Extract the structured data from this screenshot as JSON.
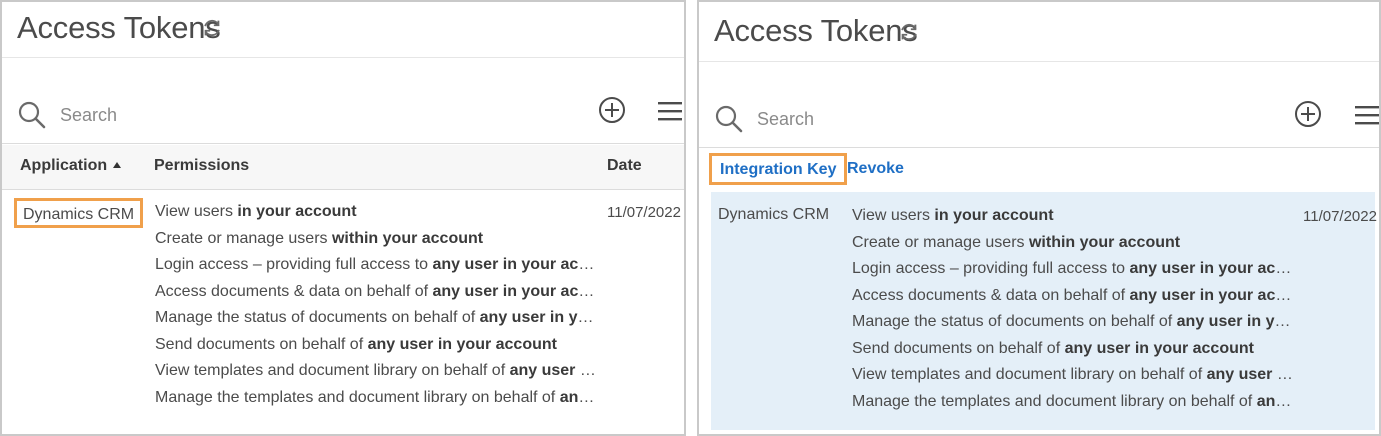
{
  "panels": [
    {
      "title": "Access Tokens",
      "search": {
        "placeholder": "Search"
      },
      "columns": {
        "application": "Application",
        "permissions": "Permissions",
        "date": "Date"
      },
      "row": {
        "application": "Dynamics CRM",
        "date": "11/07/2022"
      }
    },
    {
      "title": "Access Tokens",
      "search": {
        "placeholder": "Search"
      },
      "actions": {
        "integration_key": "Integration Key",
        "revoke": "Revoke"
      },
      "row": {
        "application": "Dynamics CRM",
        "date": "11/07/2022"
      }
    }
  ],
  "permissions": [
    {
      "plain": "View users ",
      "bold": "in your account"
    },
    {
      "plain": "Create or manage users ",
      "bold": "within your account"
    },
    {
      "plain": "Login access – providing full access to ",
      "bold": "any user in your account"
    },
    {
      "plain": "Access documents & data on behalf of ",
      "bold": "any user in your account"
    },
    {
      "plain": "Manage the status of documents on behalf of ",
      "bold": "any user in your account"
    },
    {
      "plain": "Send documents on behalf of ",
      "bold": "any user in your account"
    },
    {
      "plain": "View templates and document library on behalf of ",
      "bold": "any user in your account"
    },
    {
      "plain": "Manage the templates and document library on behalf of ",
      "bold": "any user in your account"
    }
  ],
  "colors": {
    "accent": "#1f6fc5",
    "highlight": "#f0a04b",
    "selected_row": "#e4eff8"
  },
  "icons": [
    "refresh-icon",
    "search-icon",
    "add-icon",
    "menu-icon",
    "sort-ascending-icon"
  ]
}
